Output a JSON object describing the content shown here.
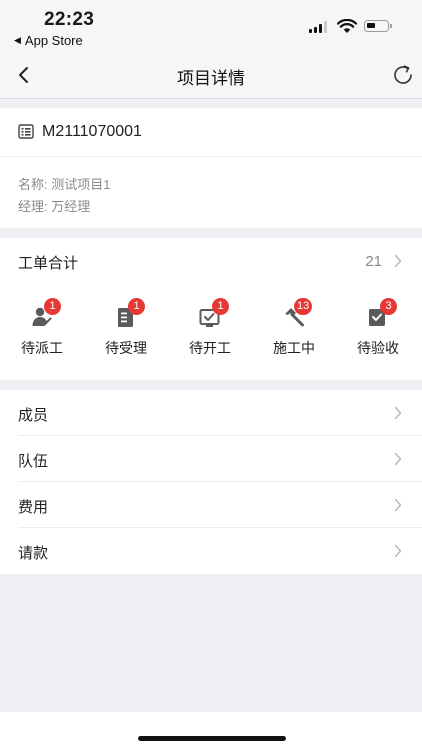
{
  "status_bar": {
    "time": "22:23",
    "back_app": "App Store"
  },
  "nav": {
    "title": "项目详情"
  },
  "project": {
    "code": "M2111070001",
    "name_label": "名称:",
    "name_value": "测试项目1",
    "manager_label": "经理:",
    "manager_value": "万经理"
  },
  "orders": {
    "title": "工单合计",
    "total": "21",
    "statuses": [
      {
        "label": "待派工",
        "badge": "1",
        "icon": "dispatch-person-icon"
      },
      {
        "label": "待受理",
        "badge": "1",
        "icon": "clipboard-icon"
      },
      {
        "label": "待开工",
        "badge": "1",
        "icon": "monitor-check-icon"
      },
      {
        "label": "施工中",
        "badge": "13",
        "icon": "hammer-icon"
      },
      {
        "label": "待验收",
        "badge": "3",
        "icon": "inspect-icon"
      }
    ]
  },
  "menu": {
    "items": [
      {
        "label": "成员"
      },
      {
        "label": "队伍"
      },
      {
        "label": "费用"
      },
      {
        "label": "请款"
      }
    ]
  },
  "colors": {
    "badge": "#e53935",
    "icon": "#555555",
    "background": "#f0f0f4"
  }
}
